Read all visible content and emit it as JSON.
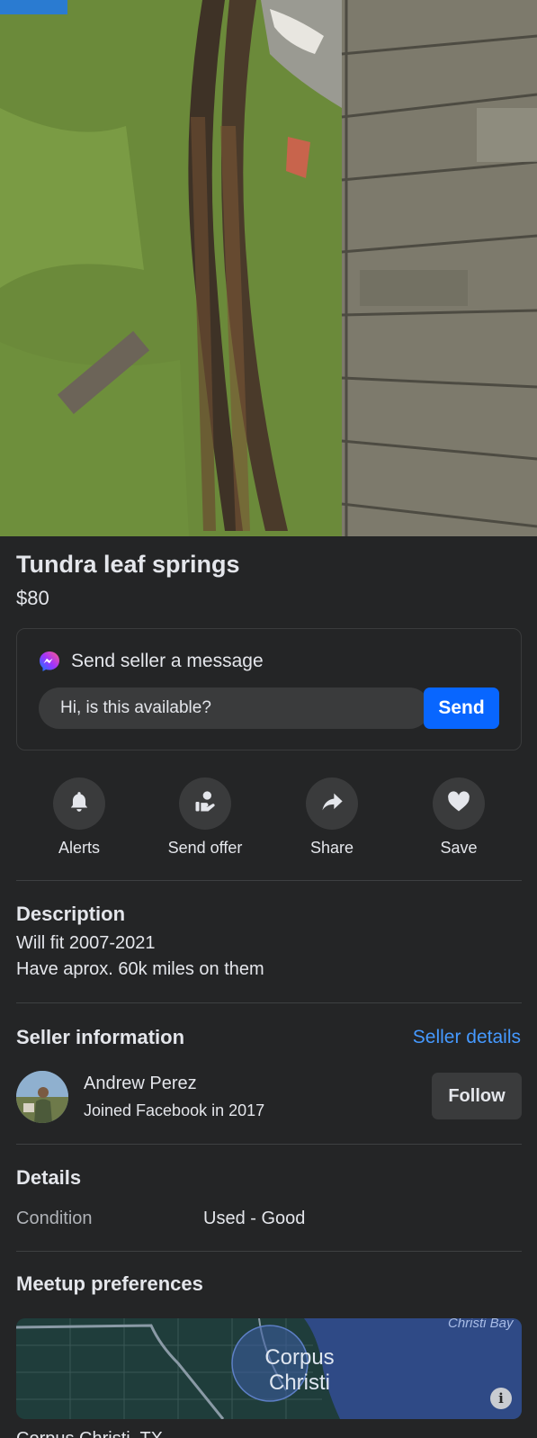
{
  "listing": {
    "title": "Tundra leaf springs",
    "price": "$80"
  },
  "message": {
    "heading": "Send seller a message",
    "input_value": "Hi, is this available?",
    "send_label": "Send"
  },
  "actions": [
    {
      "label": "Alerts",
      "icon": "bell-icon"
    },
    {
      "label": "Send offer",
      "icon": "send-offer-icon"
    },
    {
      "label": "Share",
      "icon": "share-arrow-icon"
    },
    {
      "label": "Save",
      "icon": "heart-icon"
    }
  ],
  "description": {
    "heading": "Description",
    "lines": [
      "Will fit 2007-2021",
      "Have aprox. 60k miles on them"
    ]
  },
  "seller": {
    "heading": "Seller information",
    "details_link": "Seller details",
    "name": "Andrew Perez",
    "joined": "Joined Facebook in 2017",
    "follow_label": "Follow"
  },
  "details": {
    "heading": "Details",
    "condition_label": "Condition",
    "condition_value": "Used - Good"
  },
  "meetup": {
    "heading": "Meetup preferences",
    "map_city": "Corpus Christi",
    "map_bay": "Christi Bay",
    "location": "Corpus Christi, TX"
  },
  "colors": {
    "background": "#242526",
    "accent": "#0866ff",
    "link": "#4599ff"
  }
}
